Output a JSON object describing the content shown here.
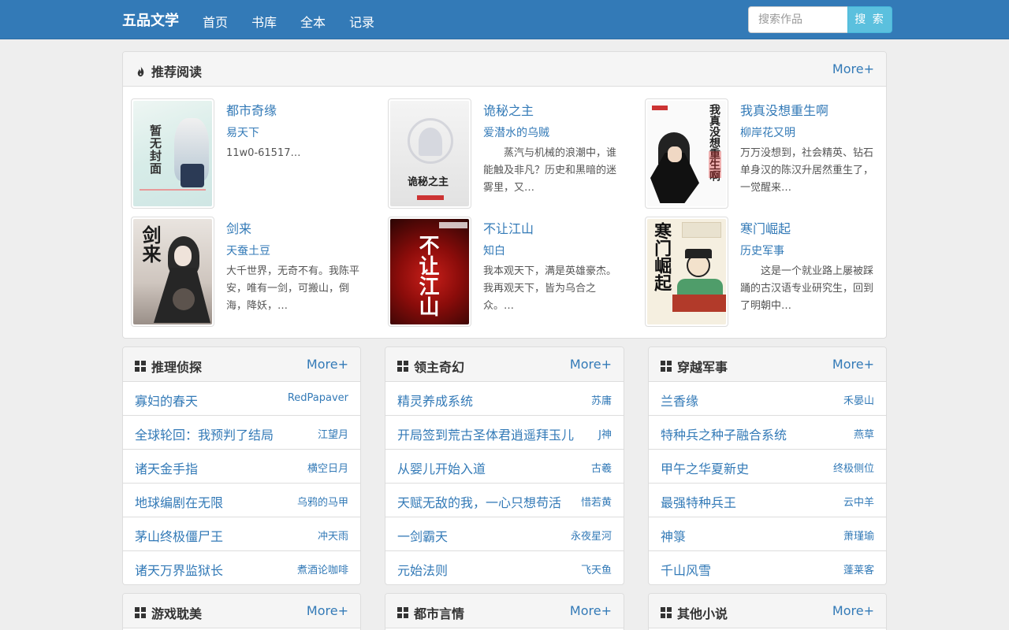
{
  "navbar": {
    "brand": "五品文学",
    "links": [
      "首页",
      "书库",
      "全本",
      "记录"
    ],
    "search_placeholder": "搜索作品",
    "search_button": "搜 索"
  },
  "recommend": {
    "title": "推荐阅读",
    "more": "More+",
    "icon": "fire-icon",
    "books": [
      {
        "title": "都市奇缘",
        "author": "易天下",
        "desc": "11w0-61517…",
        "cover_text": "暂无封面"
      },
      {
        "title": "诡秘之主",
        "author": "爱潜水的乌贼",
        "desc": "蒸汽与机械的浪潮中，谁能触及非凡？历史和黑暗的迷雾里，又…",
        "cover_text": "诡秘之主"
      },
      {
        "title": "我真没想重生啊",
        "author": "柳岸花又明",
        "desc": "万万没想到，社会精英、钻石单身汉的陈汉升居然重生了，一觉醒来…",
        "cover_text": "我真没想重生啊"
      },
      {
        "title": "剑来",
        "author": "天蚕土豆",
        "desc": "大千世界，无奇不有。我陈平安，唯有一剑，可搬山，倒海，降妖，…",
        "cover_text": "剑来"
      },
      {
        "title": "不让江山",
        "author": "知白",
        "desc": "我本观天下，满是英雄豪杰。我再观天下，皆为乌合之众。…",
        "cover_text": "不让江山"
      },
      {
        "title": "寒门崛起",
        "author": "历史军事",
        "desc": "这是一个就业路上屡被踩踊的古汉语专业研究生，回到了明朝中…",
        "cover_text": "寒门崛起"
      }
    ]
  },
  "categories": [
    {
      "title": "推理侦探",
      "more": "More+",
      "icon": "grid-icon",
      "items": [
        {
          "title": "寡妇的春天",
          "author": "RedPapaver"
        },
        {
          "title": "全球轮回：我预判了结局",
          "author": "江望月"
        },
        {
          "title": "诸天金手指",
          "author": "横空日月"
        },
        {
          "title": "地球编剧在无限",
          "author": "乌鸦的马甲"
        },
        {
          "title": "茅山终极僵尸王",
          "author": "冲天雨"
        },
        {
          "title": "诸天万界监狱长",
          "author": "煮酒论咖啡"
        }
      ]
    },
    {
      "title": "领主奇幻",
      "more": "More+",
      "icon": "grid-icon",
      "items": [
        {
          "title": "精灵养成系统",
          "author": "苏庸"
        },
        {
          "title": "开局签到荒古圣体君逍遥拜玉儿",
          "author": "J神"
        },
        {
          "title": "从婴儿开始入道",
          "author": "古羲"
        },
        {
          "title": "天赋无敌的我，一心只想苟活",
          "author": "惜若黄"
        },
        {
          "title": "一剑霸天",
          "author": "永夜星河"
        },
        {
          "title": "元始法则",
          "author": "飞天鱼"
        }
      ]
    },
    {
      "title": "穿越军事",
      "more": "More+",
      "icon": "grid-icon",
      "items": [
        {
          "title": "兰香缘",
          "author": "禾晏山"
        },
        {
          "title": "特种兵之种子融合系统",
          "author": "燕草"
        },
        {
          "title": "甲午之华夏新史",
          "author": "终极侧位"
        },
        {
          "title": "最强特种兵王",
          "author": "云中羊"
        },
        {
          "title": "神箓",
          "author": "萧瑾瑜"
        },
        {
          "title": "千山风雪",
          "author": "蓬莱客"
        }
      ]
    }
  ],
  "bottom_categories": [
    {
      "title": "游戏耽美",
      "more": "More+",
      "icon": "grid-icon"
    },
    {
      "title": "都市言情",
      "more": "More+",
      "icon": "grid-icon"
    },
    {
      "title": "其他小说",
      "more": "More+",
      "icon": "grid-icon"
    }
  ],
  "colors": {
    "navbar": "#337ab7",
    "link": "#337ab7",
    "search_button": "#5bc0de",
    "background": "#eeeeee"
  }
}
